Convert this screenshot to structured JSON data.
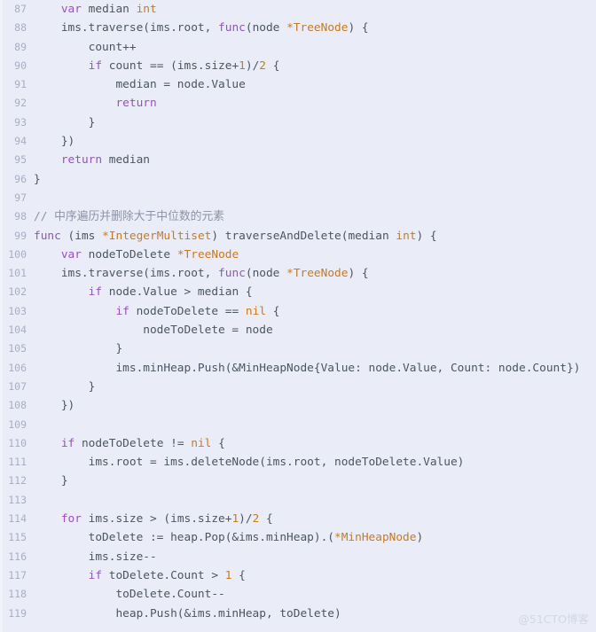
{
  "editor": {
    "language": "go",
    "background_color": "#eaecf7",
    "text_color": "#4b5563",
    "gutter_color": "#a9aec4",
    "keyword_color": "#9a4fc4",
    "type_color": "#c77b20",
    "number_color": "#c77b20",
    "comment_color": "#8d93a6",
    "first_line_number": 87,
    "last_line_number": 119
  },
  "watermark": {
    "text": "@51CTO博客"
  },
  "lines": [
    {
      "number": "87",
      "text": "    var median int"
    },
    {
      "number": "88",
      "text": "    ims.traverse(ims.root, func(node *TreeNode) {"
    },
    {
      "number": "89",
      "text": "        count++"
    },
    {
      "number": "90",
      "text": "        if count == (ims.size+1)/2 {"
    },
    {
      "number": "91",
      "text": "            median = node.Value"
    },
    {
      "number": "92",
      "text": "            return"
    },
    {
      "number": "93",
      "text": "        }"
    },
    {
      "number": "94",
      "text": "    })"
    },
    {
      "number": "95",
      "text": "    return median"
    },
    {
      "number": "96",
      "text": "}"
    },
    {
      "number": "97",
      "text": ""
    },
    {
      "number": "98",
      "text": "// 中序遍历并删除大于中位数的元素"
    },
    {
      "number": "99",
      "text": "func (ims *IntegerMultiset) traverseAndDelete(median int) {"
    },
    {
      "number": "100",
      "text": "    var nodeToDelete *TreeNode"
    },
    {
      "number": "101",
      "text": "    ims.traverse(ims.root, func(node *TreeNode) {"
    },
    {
      "number": "102",
      "text": "        if node.Value > median {"
    },
    {
      "number": "103",
      "text": "            if nodeToDelete == nil {"
    },
    {
      "number": "104",
      "text": "                nodeToDelete = node"
    },
    {
      "number": "105",
      "text": "            }"
    },
    {
      "number": "106",
      "text": "            ims.minHeap.Push(&MinHeapNode{Value: node.Value, Count: node.Count})"
    },
    {
      "number": "107",
      "text": "        }"
    },
    {
      "number": "108",
      "text": "    })"
    },
    {
      "number": "109",
      "text": ""
    },
    {
      "number": "110",
      "text": "    if nodeToDelete != nil {"
    },
    {
      "number": "111",
      "text": "        ims.root = ims.deleteNode(ims.root, nodeToDelete.Value)"
    },
    {
      "number": "112",
      "text": "    }"
    },
    {
      "number": "113",
      "text": ""
    },
    {
      "number": "114",
      "text": "    for ims.size > (ims.size+1)/2 {"
    },
    {
      "number": "115",
      "text": "        toDelete := heap.Pop(&ims.minHeap).(*MinHeapNode)"
    },
    {
      "number": "116",
      "text": "        ims.size--"
    },
    {
      "number": "117",
      "text": "        if toDelete.Count > 1 {"
    },
    {
      "number": "118",
      "text": "            toDelete.Count--"
    },
    {
      "number": "119",
      "text": "            heap.Push(&ims.minHeap, toDelete)"
    }
  ],
  "tokens": {
    "keywords": [
      "var",
      "func",
      "if",
      "return",
      "for"
    ],
    "types": [
      "int",
      "*TreeNode",
      "*IntegerMultiset",
      "*MinHeapNode",
      "nil",
      "MinHeapNode"
    ],
    "numbers": [
      "1",
      "2"
    ]
  }
}
